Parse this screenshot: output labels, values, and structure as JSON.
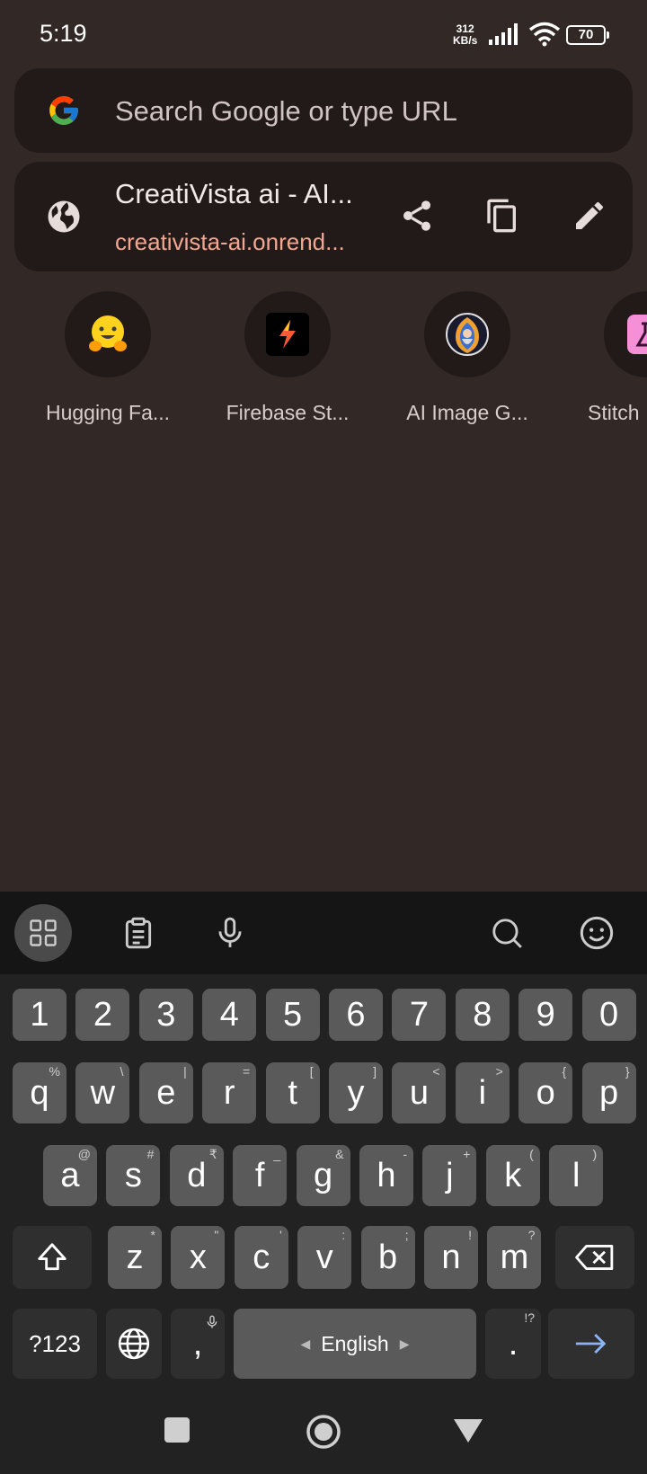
{
  "status_bar": {
    "time": "5:19",
    "net_speed_value": "312",
    "net_speed_unit": "KB/s",
    "battery": "70"
  },
  "search": {
    "placeholder": "Search Google or type URL"
  },
  "current_page": {
    "title": "CreatiVista ai - AI...",
    "url": "creativista-ai.onrend..."
  },
  "shortcuts": [
    {
      "label": "Hugging Fa...",
      "icon": "hugging-face-icon"
    },
    {
      "label": "Firebase St...",
      "icon": "firebase-studio-icon"
    },
    {
      "label": "AI Image G...",
      "icon": "ai-image-generator-icon"
    },
    {
      "label": "Stitch",
      "icon": "stitch-icon"
    }
  ],
  "keyboard": {
    "numbers": [
      "1",
      "2",
      "3",
      "4",
      "5",
      "6",
      "7",
      "8",
      "9",
      "0"
    ],
    "row1": [
      [
        "q",
        "%"
      ],
      [
        "w",
        "\\"
      ],
      [
        "e",
        "|"
      ],
      [
        "r",
        "="
      ],
      [
        "t",
        "["
      ],
      [
        "y",
        "]"
      ],
      [
        "u",
        "<"
      ],
      [
        "i",
        ">"
      ],
      [
        "o",
        "{"
      ],
      [
        "p",
        "}"
      ]
    ],
    "row2": [
      [
        "a",
        "@"
      ],
      [
        "s",
        "#"
      ],
      [
        "d",
        "₹"
      ],
      [
        "f",
        "_"
      ],
      [
        "g",
        "&"
      ],
      [
        "h",
        "-"
      ],
      [
        "j",
        "+"
      ],
      [
        "k",
        "("
      ],
      [
        "l",
        ")"
      ]
    ],
    "row3": [
      [
        "z",
        "*"
      ],
      [
        "x",
        "\""
      ],
      [
        "c",
        "'"
      ],
      [
        "v",
        ":"
      ],
      [
        "b",
        ";"
      ],
      [
        "n",
        "!"
      ],
      [
        "m",
        "?"
      ]
    ],
    "symbols_key": "?123",
    "comma": ",",
    "space_label": "English",
    "period": ".",
    "period_hint": "!?"
  },
  "colors": {
    "background": "#322826",
    "card": "#221a19",
    "url": "#f3a692",
    "enter_arrow": "#8ab4f8"
  }
}
